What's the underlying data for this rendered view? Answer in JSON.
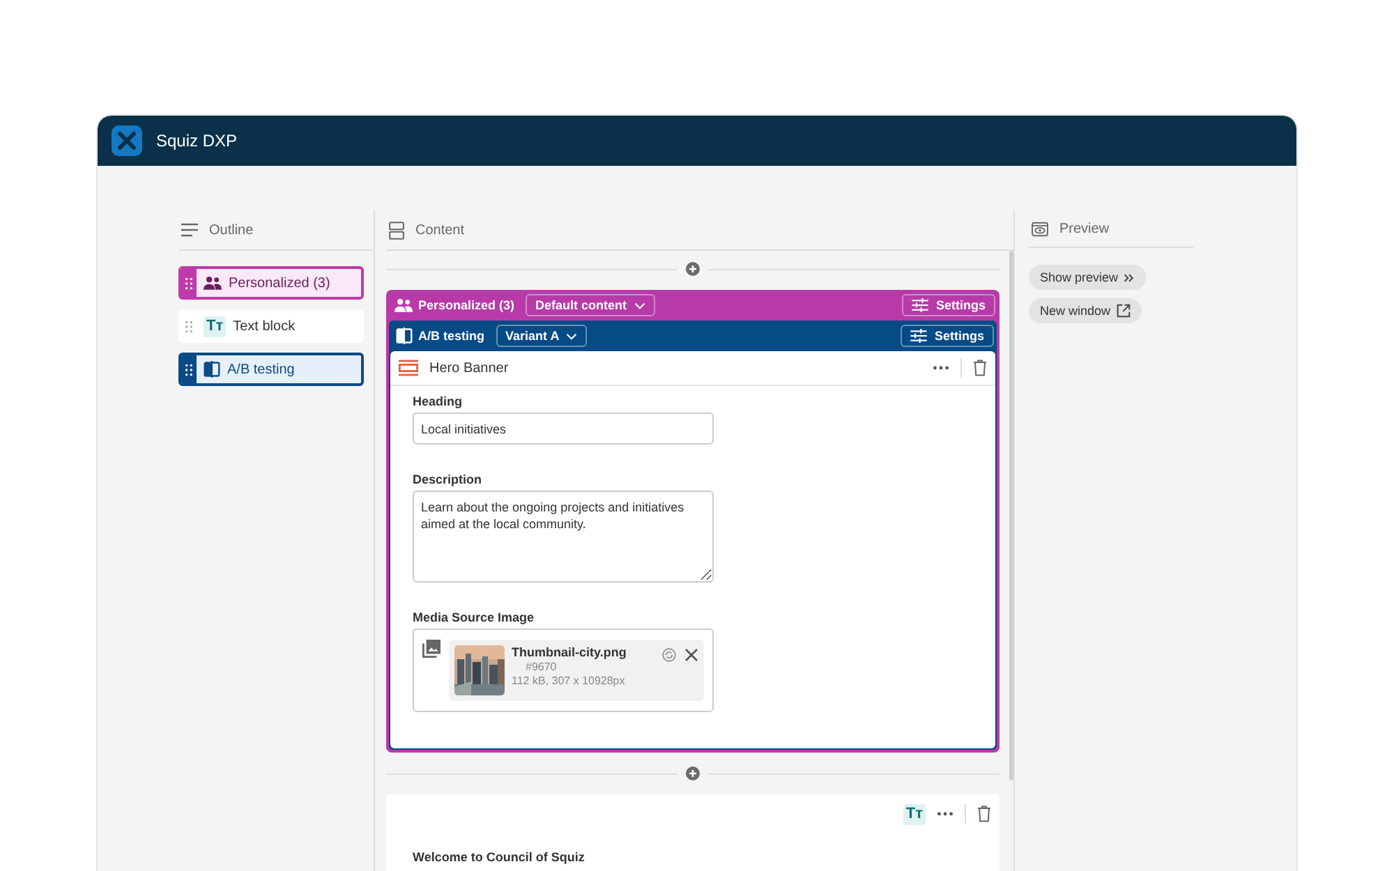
{
  "window": {
    "title": "Squiz DXP"
  },
  "outline": {
    "title": "Outline",
    "items": [
      {
        "kind": "personalized",
        "label": "Personalized (3)"
      },
      {
        "kind": "text",
        "label": "Text block",
        "glyph": "Tᴛ"
      },
      {
        "kind": "ab",
        "label": "A/B testing"
      }
    ]
  },
  "content": {
    "title": "Content",
    "personalized": {
      "label": "Personalized (3)",
      "dropdown": "Default content",
      "settings": "Settings",
      "ab": {
        "label": "A/B testing",
        "dropdown": "Variant A",
        "settings": "Settings",
        "component": {
          "title": "Hero Banner",
          "fields": [
            {
              "kind": "input",
              "label": "Heading",
              "value": "Local initiatives"
            },
            {
              "kind": "textarea",
              "label": "Description",
              "value": "Learn about the ongoing projects and initiatives aimed at the local community."
            },
            {
              "kind": "media",
              "label": "Media Source Image",
              "file": {
                "name": "Thumbnail-city.png",
                "id": "#9670",
                "meta": "112 kB, 307 x 10928px"
              }
            }
          ]
        }
      }
    },
    "text_block": {
      "glyph": "Tᴛ",
      "heading": "Welcome to Council of Squiz"
    }
  },
  "preview": {
    "title": "Preview",
    "buttons": [
      {
        "kind": "expand",
        "label": "Show preview"
      },
      {
        "kind": "external",
        "label": "New window"
      }
    ]
  }
}
